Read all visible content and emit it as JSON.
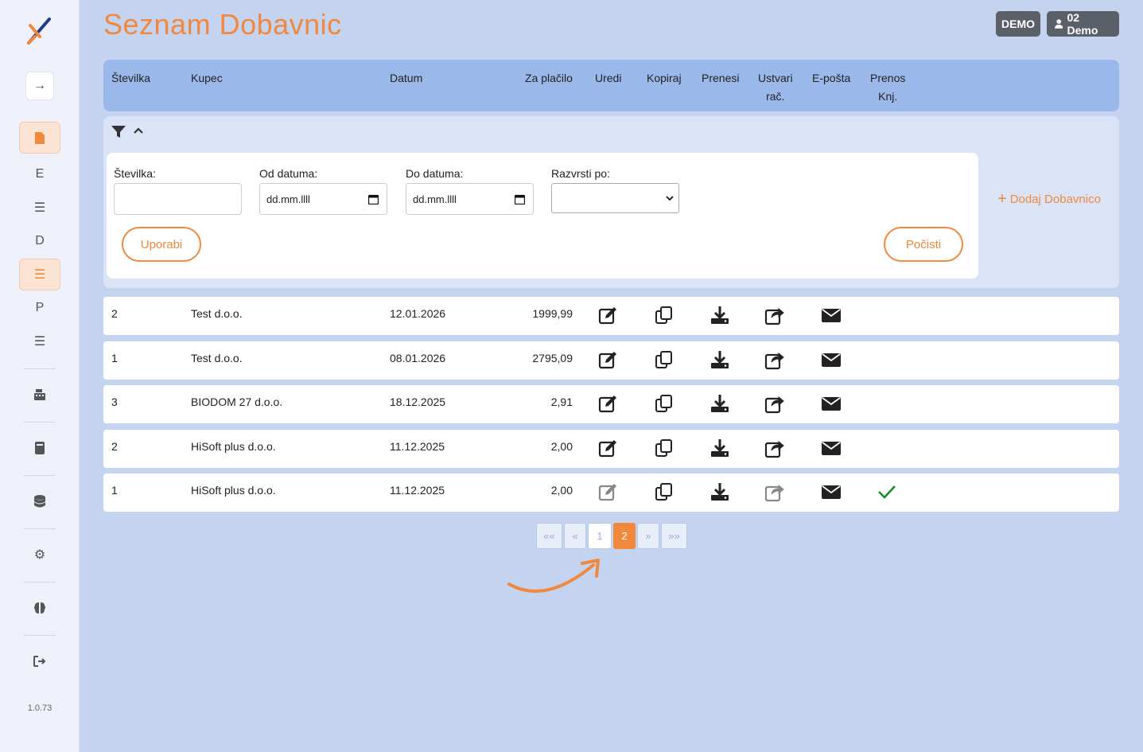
{
  "app": {
    "title": "Seznam Dobavnic",
    "version": "1.0.73",
    "accent_color": "#f0883e"
  },
  "topbar": {
    "demo_badge": "DEMO",
    "user_label": "02 Demo"
  },
  "sidebar": {
    "items": [
      {
        "icon": "file-icon",
        "label": "",
        "active": true
      },
      {
        "icon": "letter-e",
        "label": "E",
        "active": false
      },
      {
        "icon": "list-icon",
        "label": "",
        "active": false
      },
      {
        "icon": "letter-d",
        "label": "D",
        "active": false
      },
      {
        "icon": "list-icon",
        "label": "",
        "active": true
      },
      {
        "icon": "letter-p",
        "label": "P",
        "active": false
      },
      {
        "icon": "list-icon",
        "label": "",
        "active": false
      },
      {
        "icon": "cash-register-icon",
        "label": "",
        "active": false
      },
      {
        "icon": "book-icon",
        "label": "",
        "active": false
      },
      {
        "icon": "database-icon",
        "label": "",
        "active": false
      },
      {
        "icon": "gear-icon",
        "label": "",
        "active": false
      },
      {
        "icon": "brain-icon",
        "label": "",
        "active": false
      },
      {
        "icon": "logout-icon",
        "label": "",
        "active": false
      }
    ]
  },
  "table": {
    "headers": {
      "stevilka": "Številka",
      "kupec": "Kupec",
      "datum": "Datum",
      "za_placilo": "Za plačilo",
      "uredi": "Uredi",
      "kopiraj": "Kopiraj",
      "prenesi": "Prenesi",
      "ustvari_1": "Ustvari",
      "ustvari_2": "rač.",
      "eposta": "E-pošta",
      "prenos_1": "Prenos",
      "prenos_2": "Knj."
    },
    "rows": [
      {
        "stevilka": "2",
        "kupec": "Test d.o.o.",
        "datum": "12.01.2026",
        "za_placilo": "1999,99",
        "editable": true,
        "prenos_knj": false
      },
      {
        "stevilka": "1",
        "kupec": "Test d.o.o.",
        "datum": "08.01.2026",
        "za_placilo": "2795,09",
        "editable": true,
        "prenos_knj": false
      },
      {
        "stevilka": "3",
        "kupec": "BIODOM 27 d.o.o.",
        "datum": "18.12.2025",
        "za_placilo": "2,91",
        "editable": true,
        "prenos_knj": false
      },
      {
        "stevilka": "2",
        "kupec": "HiSoft plus d.o.o.",
        "datum": "11.12.2025",
        "za_placilo": "2,00",
        "editable": true,
        "prenos_knj": false
      },
      {
        "stevilka": "1",
        "kupec": "HiSoft plus d.o.o.",
        "datum": "11.12.2025",
        "za_placilo": "2,00",
        "editable": false,
        "prenos_knj": true
      }
    ]
  },
  "filter": {
    "stevilka_label": "Številka:",
    "stevilka_value": "",
    "od_label": "Od datuma:",
    "od_placeholder": "dd.mm.llll",
    "do_label": "Do datuma:",
    "do_placeholder": "dd.mm.llll",
    "razvrsti_label": "Razvrsti po:",
    "razvrsti_value": "",
    "uporabi_label": "Uporabi",
    "pocisti_label": "Počisti",
    "add_label": "Dodaj Dobavnico"
  },
  "pagination": {
    "first": "««",
    "prev": "«",
    "pages": [
      "1",
      "2"
    ],
    "current": "2",
    "next": "»",
    "last": "»»"
  }
}
